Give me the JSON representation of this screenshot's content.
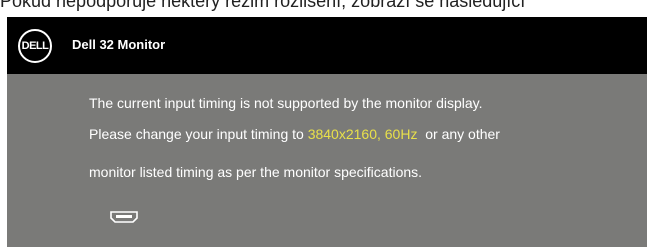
{
  "document": {
    "header_text": "Pokud nepodporuje některý režim rozlišení, zobrazí se následující"
  },
  "osd": {
    "logo_text": "DELL",
    "title": "Dell 32 Monitor",
    "message": {
      "line1": "The current input timing is not supported by the monitor display.",
      "line2_prefix": "Please change your input timing to ",
      "line2_highlight": "3840x2160, 60Hz",
      "line2_suffix": "  or any other",
      "line3": "monitor listed timing as per the monitor specifications."
    },
    "input_icon": "hdmi-input-icon"
  },
  "colors": {
    "osd_background": "#7a7a78",
    "titlebar_background": "#000000",
    "highlight": "#e8e04a",
    "text": "#ffffff"
  }
}
